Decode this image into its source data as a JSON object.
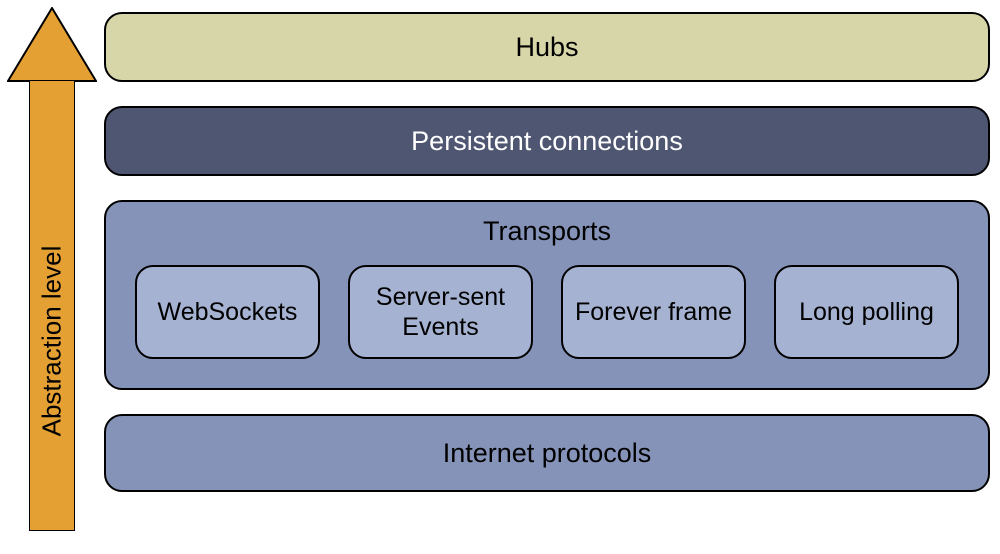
{
  "arrow": {
    "label": "Abstraction level"
  },
  "layers": {
    "hubs": "Hubs",
    "persistent": "Persistent connections",
    "transports": {
      "title": "Transports",
      "items": [
        "WebSockets",
        "Server-sent Events",
        "Forever frame",
        "Long polling"
      ]
    },
    "internet": "Internet protocols"
  }
}
